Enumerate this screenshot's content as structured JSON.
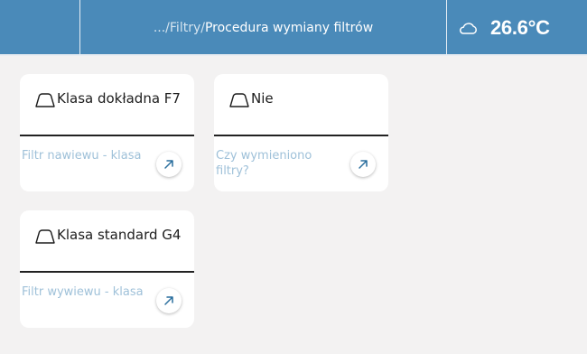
{
  "header": {
    "breadcrumb_prefix": ".../Filtry/",
    "breadcrumb_current": "Procedura wymiany filtrów",
    "weather_icon": "cloud-icon",
    "temperature": "26.6°C"
  },
  "cards": [
    {
      "value": "Klasa dokładna F7",
      "label": "Filtr nawiewu - klasa",
      "icon": "filter-shape-icon",
      "action_icon": "arrow-up-right-icon"
    },
    {
      "value": "Nie",
      "label": "Czy wymieniono filtry?",
      "icon": "filter-shape-icon",
      "action_icon": "arrow-up-right-icon"
    },
    {
      "value": "Klasa standard G4",
      "label": "Filtr wywiewu - klasa",
      "icon": "filter-shape-icon",
      "action_icon": "arrow-up-right-icon"
    }
  ],
  "colors": {
    "header_bg": "#4a8ab9",
    "page_bg": "#f3f2f2",
    "label_color": "#9fc1d9",
    "action_arrow": "#2a6f9e"
  }
}
